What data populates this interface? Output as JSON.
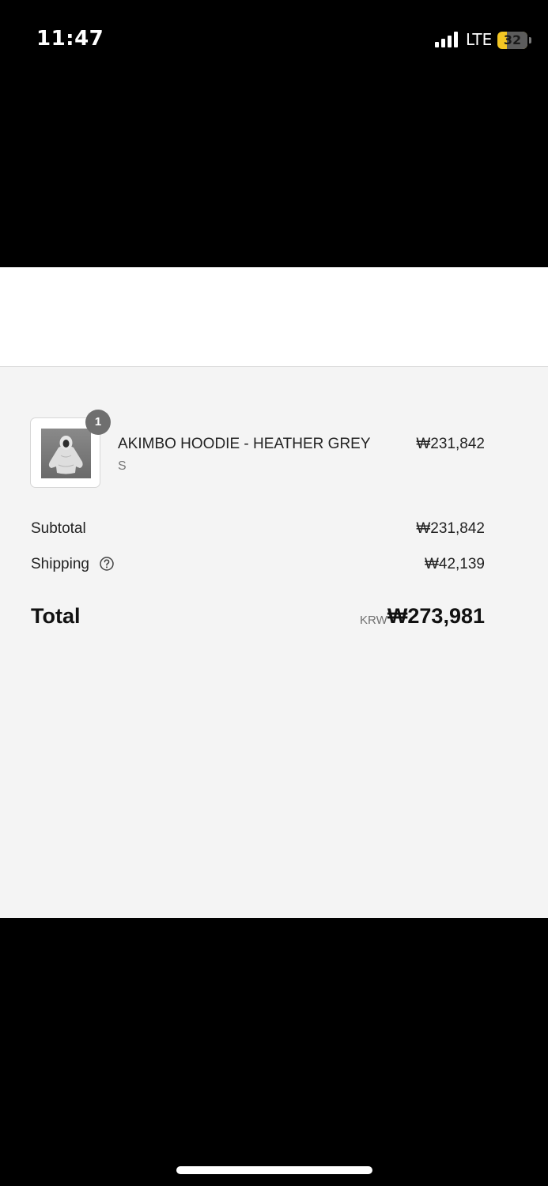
{
  "status_bar": {
    "time": "11:47",
    "network": "LTE",
    "battery_percent": "32",
    "battery_level": 0.32,
    "icons": [
      "signal-icon",
      "battery-icon"
    ]
  },
  "order": {
    "item": {
      "quantity": "1",
      "name": "AKIMBO HOODIE - HEATHER GREY",
      "variant": "S",
      "price": "₩231,842",
      "image": "hoodie-product-photo"
    },
    "subtotal_label": "Subtotal",
    "subtotal_value": "₩231,842",
    "shipping_label": "Shipping",
    "shipping_icon": "help-circle-icon",
    "shipping_value": "₩42,139",
    "total_label": "Total",
    "currency_code": "KRW",
    "total_value": "₩273,981"
  },
  "colors": {
    "summary_background": "#f4f4f4",
    "battery_accent": "#f3c624",
    "badge": "#6f6f6f"
  }
}
